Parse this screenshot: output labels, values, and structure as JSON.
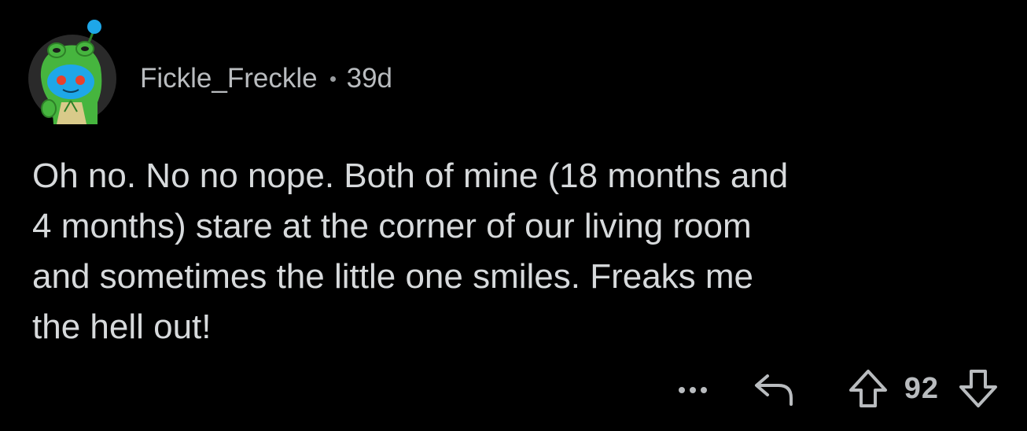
{
  "comment": {
    "username": "Fickle_Freckle",
    "age": "39d",
    "body": "Oh no. No no nope. Both of mine (18 months and\n4 months) stare at the corner of our living room\nand sometimes the little one smiles. Freaks me\nthe hell out!",
    "score": "92"
  },
  "icons": {
    "avatar": "snoo-frog-hood-avatar",
    "more": "more-dots-icon",
    "reply": "reply-arrow-icon",
    "upvote": "upvote-arrow-icon",
    "downvote": "downvote-arrow-icon"
  },
  "colors": {
    "background": "#000000",
    "text": "#d7dadc",
    "meta": "#b9bcbf",
    "avatar_green": "#46b53e",
    "avatar_blue": "#1ea7e8"
  }
}
